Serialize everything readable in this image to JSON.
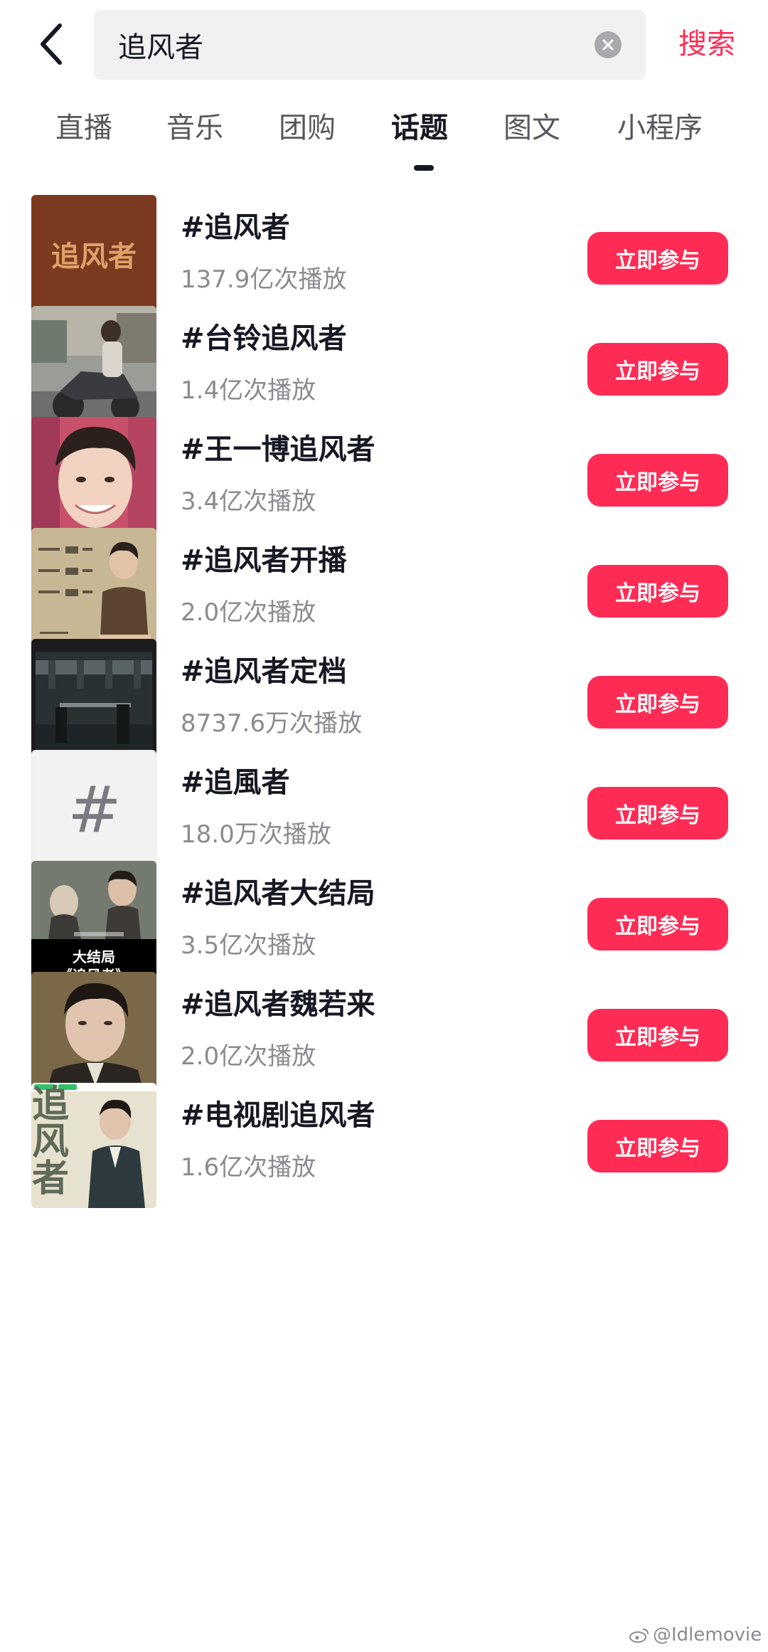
{
  "header": {
    "search_value": "追风者",
    "search_button": "搜索"
  },
  "tabs": [
    {
      "label": "直播",
      "active": false
    },
    {
      "label": "音乐",
      "active": false
    },
    {
      "label": "团购",
      "active": false
    },
    {
      "label": "话题",
      "active": true
    },
    {
      "label": "图文",
      "active": false
    },
    {
      "label": "小程序",
      "active": false
    }
  ],
  "results": [
    {
      "title": "#追风者",
      "plays": "137.9亿次播放",
      "thumb_text": "追风者",
      "action": "立即参与"
    },
    {
      "title": "#台铃追风者",
      "plays": "1.4亿次播放",
      "action": "立即参与"
    },
    {
      "title": "#王一博追风者",
      "plays": "3.4亿次播放",
      "action": "立即参与"
    },
    {
      "title": "#追风者开播",
      "plays": "2.0亿次播放",
      "action": "立即参与"
    },
    {
      "title": "#追风者定档",
      "plays": "8737.6万次播放",
      "action": "立即参与"
    },
    {
      "title": "#追風者",
      "plays": "18.0万次播放",
      "thumb_text": "#",
      "action": "立即参与"
    },
    {
      "title": "#追风者大结局",
      "plays": "3.5亿次播放",
      "thumb_text": [
        "大结局",
        "《追风者》"
      ],
      "action": "立即参与"
    },
    {
      "title": "#追风者魏若来",
      "plays": "2.0亿次播放",
      "action": "立即参与"
    },
    {
      "title": "#电视剧追风者",
      "plays": "1.6亿次播放",
      "thumb_text": "追风者",
      "action": "立即参与"
    }
  ],
  "watermark": "@Idlemovie",
  "colors": {
    "accent": "#fe2c55",
    "text": "#161823",
    "secondary": "#8a8b91",
    "search_bg": "#f1f1f2"
  },
  "icons": {
    "back": "chevron-left-icon",
    "clear": "clear-x-icon",
    "weibo": "weibo-icon"
  }
}
